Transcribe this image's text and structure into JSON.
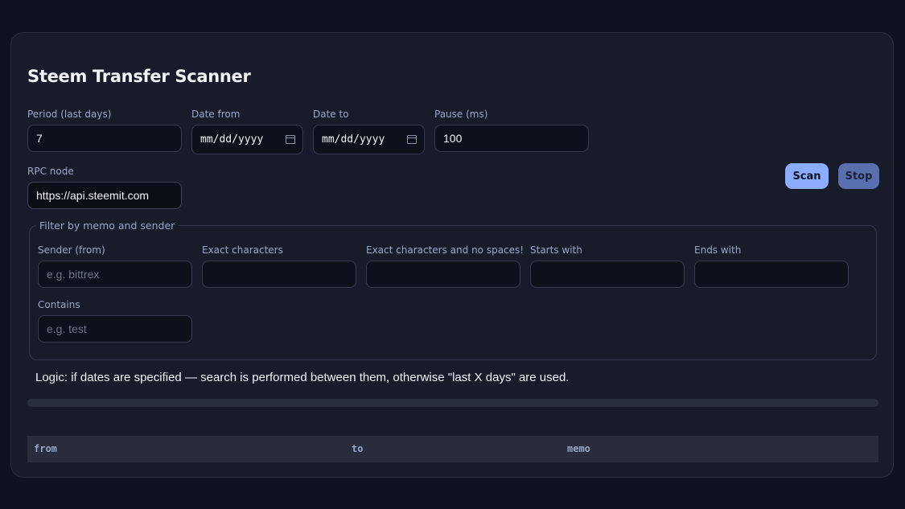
{
  "app": {
    "title": "Steem Transfer Scanner"
  },
  "scan_form": {
    "period": {
      "label": "Period (last days)",
      "value": "7"
    },
    "date_from": {
      "label": "Date from",
      "value": "mm/dd/yyyy"
    },
    "date_to": {
      "label": "Date to",
      "value": "mm/dd/yyyy"
    },
    "pause": {
      "label": "Pause (ms)",
      "value": "100"
    },
    "rpc": {
      "label": "RPC node",
      "value": "https://api.steemit.com"
    }
  },
  "actions": {
    "scan_label": "Scan",
    "stop_label": "Stop"
  },
  "filter": {
    "legend": "Filter by memo and sender",
    "sender": {
      "label": "Sender (from)",
      "placeholder": "e.g. bittrex",
      "value": ""
    },
    "exact": {
      "label": "Exact characters",
      "value": ""
    },
    "exact_nospace": {
      "label": "Exact characters and no spaces!",
      "value": ""
    },
    "starts_with": {
      "label": "Starts with",
      "value": ""
    },
    "ends_with": {
      "label": "Ends with",
      "value": ""
    },
    "contains": {
      "label": "Contains",
      "placeholder": "e.g. test",
      "value": ""
    }
  },
  "logic_text": "Logic: if dates are specified — search is performed between them, otherwise \"last X days\" are used.",
  "progress": {
    "fraction": 0
  },
  "table": {
    "columns": [
      "from",
      "to",
      "memo"
    ],
    "rows": []
  },
  "colors": {
    "accent": "#8bacff",
    "stop": "#5a6fad",
    "background": "#0f1320",
    "card": "#181c2a"
  }
}
